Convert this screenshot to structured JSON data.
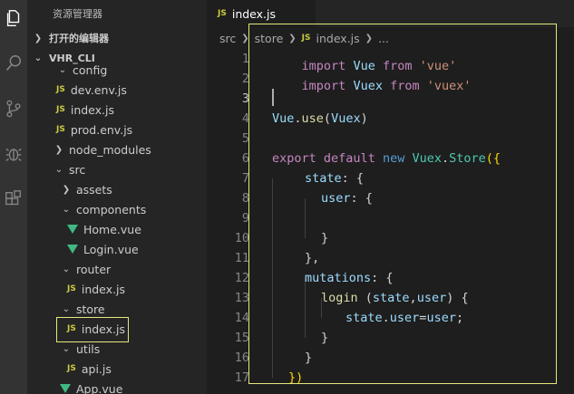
{
  "activity_bar": {
    "icons": [
      "explorer-icon",
      "search-icon",
      "source-control-icon",
      "debug-icon",
      "extensions-icon"
    ]
  },
  "sidebar": {
    "title": "资源管理器",
    "open_editors": "打开的编辑器",
    "project": "VHR_CLI",
    "items": [
      {
        "label": "config",
        "type": "folder-open"
      },
      {
        "label": "dev.env.js",
        "type": "js"
      },
      {
        "label": "index.js",
        "type": "js"
      },
      {
        "label": "prod.env.js",
        "type": "js"
      },
      {
        "label": "node_modules",
        "type": "folder"
      },
      {
        "label": "src",
        "type": "folder-open"
      },
      {
        "label": "assets",
        "type": "folder"
      },
      {
        "label": "components",
        "type": "folder-open"
      },
      {
        "label": "Home.vue",
        "type": "vue"
      },
      {
        "label": "Login.vue",
        "type": "vue"
      },
      {
        "label": "router",
        "type": "folder-open"
      },
      {
        "label": "index.js",
        "type": "js"
      },
      {
        "label": "store",
        "type": "folder-open"
      },
      {
        "label": "index.js",
        "type": "js"
      },
      {
        "label": "utils",
        "type": "folder-open"
      },
      {
        "label": "api.js",
        "type": "js"
      },
      {
        "label": "App.vue",
        "type": "vue"
      }
    ],
    "js_badge": "JS"
  },
  "tab": {
    "badge": "JS",
    "label": "index.js"
  },
  "breadcrumb": {
    "parts": [
      "src",
      "store",
      "index.js",
      "..."
    ],
    "badge": "JS"
  },
  "editor": {
    "line_numbers": [
      "1",
      "2",
      "3",
      "4",
      "5",
      "6",
      "7",
      "8",
      "9",
      "10",
      "11",
      "12",
      "13",
      "14",
      "15",
      "16",
      "17"
    ],
    "lines": {
      "l1": {
        "kw": "import",
        "id": "Vue",
        "from": "from",
        "str": "'vue'"
      },
      "l2": {
        "kw": "import",
        "id": "Vuex",
        "from": "from",
        "str": "'vuex'"
      },
      "l4": {
        "obj": "Vue",
        "dot": ".",
        "fn": "use",
        "open": "(",
        "arg": "Vuex",
        "close": ")"
      },
      "l6": {
        "kw1": "export",
        "kw2": "default",
        "kw3": "new",
        "cls1": "Vuex",
        "dot": ".",
        "cls2": "Store",
        "open": "({"
      },
      "l7": {
        "key": "state",
        "rest": ": {"
      },
      "l8": {
        "key": "user",
        "rest": ": {"
      },
      "l10": {
        "text": "}"
      },
      "l11": {
        "text": "},"
      },
      "l12": {
        "key": "mutations",
        "rest": ": {"
      },
      "l13": {
        "fn": "login",
        "open": " (",
        "p1": "state",
        "comma": ",",
        "p2": "user",
        "close": ") {"
      },
      "l14": {
        "obj": "state",
        "dot": ".",
        "prop": "user",
        "eq": "=",
        "val": "user",
        "semi": ";"
      },
      "l15": {
        "text": "}"
      },
      "l16": {
        "text": "}"
      },
      "l17": {
        "text": "})"
      }
    }
  },
  "colors": {
    "highlight": "#e6e67a",
    "js": "#cbcb41",
    "vue": "#41b883"
  }
}
